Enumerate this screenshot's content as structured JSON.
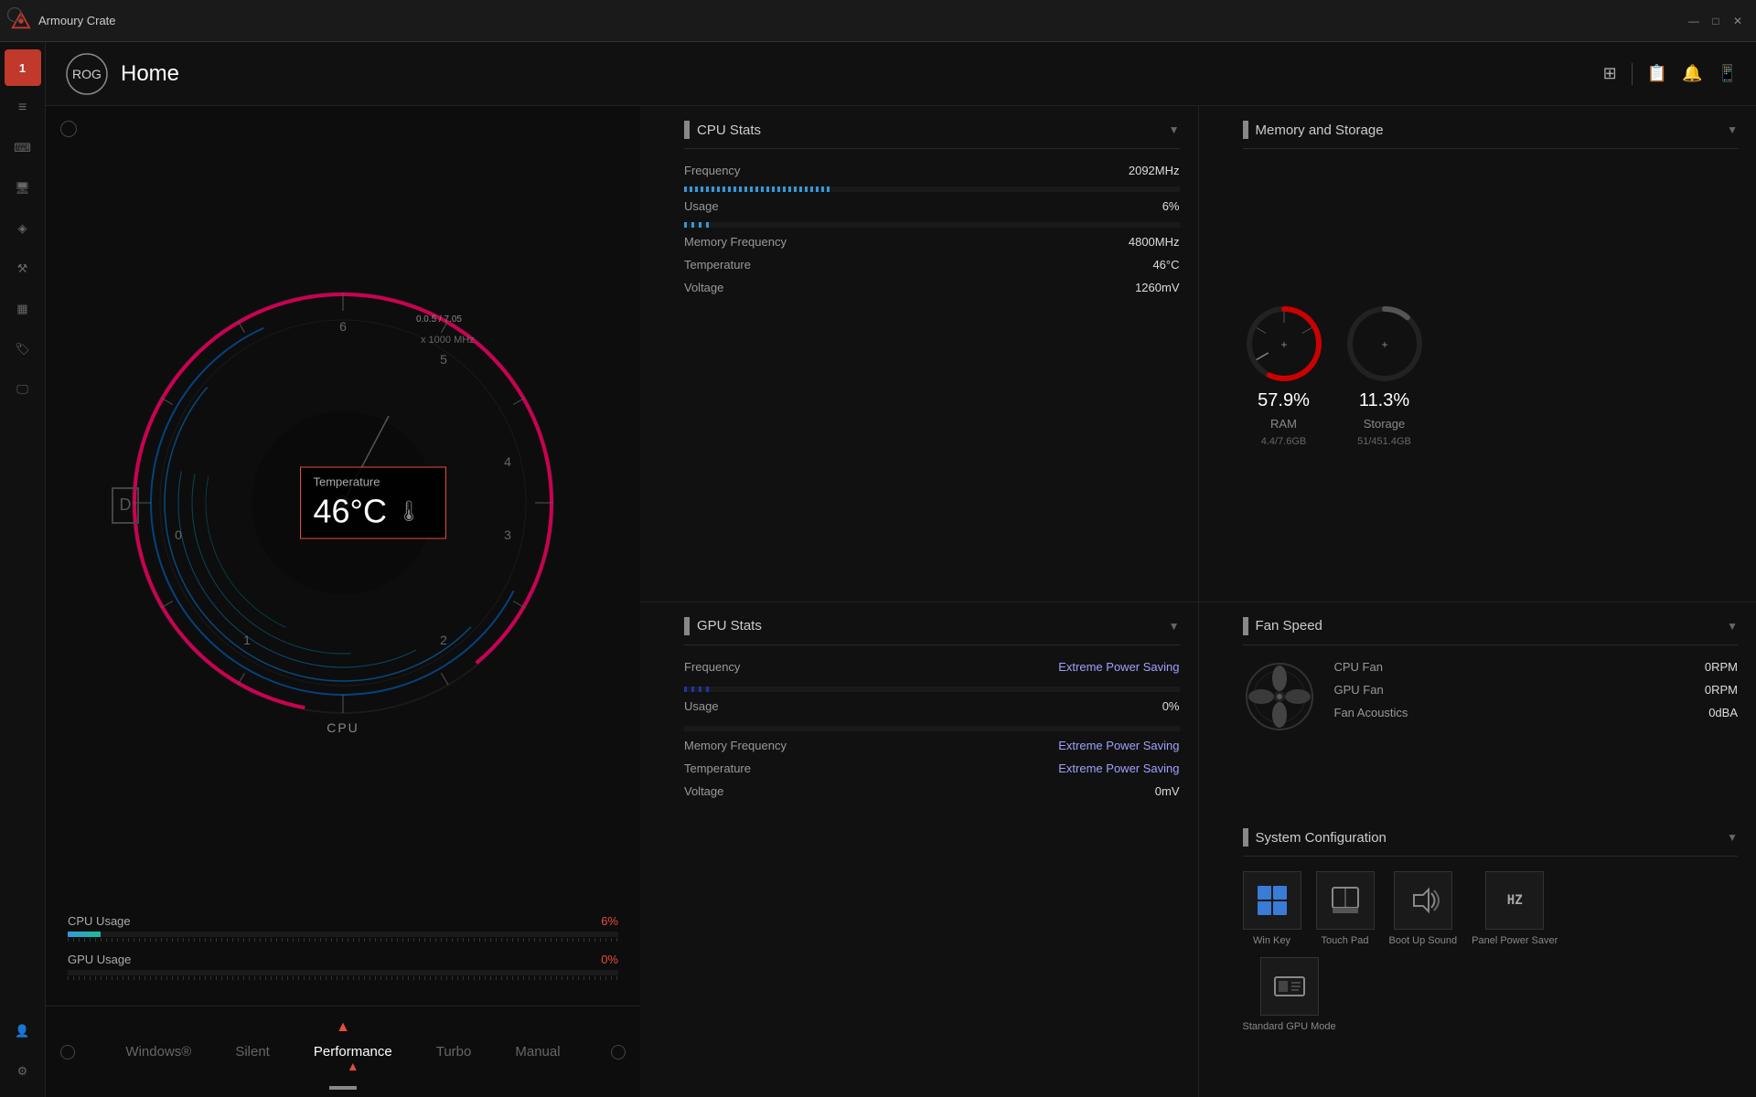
{
  "app": {
    "title": "Armoury Crate",
    "page_title": "Home"
  },
  "titlebar": {
    "title": "Armoury Crate",
    "minimize": "—",
    "maximize": "□",
    "close": "✕"
  },
  "sidebar": {
    "items": [
      {
        "id": "home",
        "icon": "⊞",
        "active": true,
        "label": "Home"
      },
      {
        "id": "menu",
        "icon": "≡",
        "label": "Menu"
      },
      {
        "id": "keyboard",
        "icon": "⌨",
        "label": "Keyboard"
      },
      {
        "id": "devices",
        "icon": "🖥",
        "label": "Devices"
      },
      {
        "id": "scene",
        "icon": "◈",
        "label": "Scene"
      },
      {
        "id": "macros",
        "icon": "⚒",
        "label": "Macros"
      },
      {
        "id": "layout",
        "icon": "▦",
        "label": "Layout"
      },
      {
        "id": "tag",
        "icon": "🏷",
        "label": "Tag"
      },
      {
        "id": "display",
        "icon": "🖵",
        "label": "Display"
      },
      {
        "id": "user",
        "icon": "👤",
        "label": "User"
      },
      {
        "id": "settings",
        "icon": "⚙",
        "label": "Settings"
      }
    ]
  },
  "header": {
    "title": "Home",
    "icons": [
      "⊞",
      "📋",
      "🔔",
      "📱"
    ]
  },
  "cpu_gauge": {
    "x1000mhz_label": "x 1000 MHz",
    "range_label": "0.0.5 / 7.05",
    "cpu_label": "CPU"
  },
  "temperature_widget": {
    "label": "Temperature",
    "value": "46°C"
  },
  "usage_bars": {
    "cpu_usage": {
      "label": "CPU Usage",
      "value": "6%",
      "percent": 6
    },
    "gpu_usage": {
      "label": "GPU Usage",
      "value": "0%",
      "percent": 0
    }
  },
  "perf_tabs": {
    "tabs": [
      {
        "id": "windows",
        "label": "Windows®",
        "active": false
      },
      {
        "id": "silent",
        "label": "Silent",
        "active": false
      },
      {
        "id": "performance",
        "label": "Performance",
        "active": true
      },
      {
        "id": "turbo",
        "label": "Turbo",
        "active": false
      },
      {
        "id": "manual",
        "label": "Manual",
        "active": false
      }
    ]
  },
  "cpu_stats": {
    "title": "CPU Stats",
    "frequency": {
      "label": "Frequency",
      "value": "2092MHz",
      "bar_percent": 30
    },
    "usage": {
      "label": "Usage",
      "value": "6%",
      "bar_percent": 6
    },
    "memory_frequency": {
      "label": "Memory Frequency",
      "value": "4800MHz"
    },
    "temperature": {
      "label": "Temperature",
      "value": "46°C"
    },
    "voltage": {
      "label": "Voltage",
      "value": "1260mV"
    }
  },
  "memory_storage": {
    "title": "Memory and Storage",
    "ram": {
      "label": "RAM",
      "percent": "57.9%",
      "detail": "4.4/7.6GB",
      "percent_num": 57.9
    },
    "storage": {
      "label": "Storage",
      "percent": "11.3%",
      "detail": "51/451.4GB",
      "percent_num": 11.3
    }
  },
  "fan_speed": {
    "title": "Fan Speed",
    "cpu_fan": {
      "label": "CPU Fan",
      "value": "0RPM"
    },
    "gpu_fan": {
      "label": "GPU Fan",
      "value": "0RPM"
    },
    "fan_acoustics": {
      "label": "Fan Acoustics",
      "value": "0dBA"
    }
  },
  "gpu_stats": {
    "title": "GPU Stats",
    "frequency": {
      "label": "Frequency",
      "value": "Extreme Power Saving",
      "bar_percent": 0
    },
    "usage": {
      "label": "Usage",
      "value": "0%",
      "bar_percent": 0
    },
    "memory_frequency": {
      "label": "Memory Frequency",
      "value": "Extreme Power Saving"
    },
    "temperature": {
      "label": "Temperature",
      "value": "Extreme Power Saving"
    },
    "voltage": {
      "label": "Voltage",
      "value": "0mV"
    }
  },
  "system_config": {
    "title": "System Configuration",
    "items": [
      {
        "id": "win-key",
        "icon": "⊞",
        "label": "Win Key"
      },
      {
        "id": "touch-pad",
        "icon": "▭",
        "label": "Touch Pad"
      },
      {
        "id": "boot-sound",
        "icon": "🔊",
        "label": "Boot Up Sound"
      },
      {
        "id": "panel-power",
        "icon": "Hz",
        "label": "Panel Power Saver"
      },
      {
        "id": "gpu-mode",
        "icon": "⊡",
        "label": "Standard GPU Mode"
      }
    ]
  }
}
